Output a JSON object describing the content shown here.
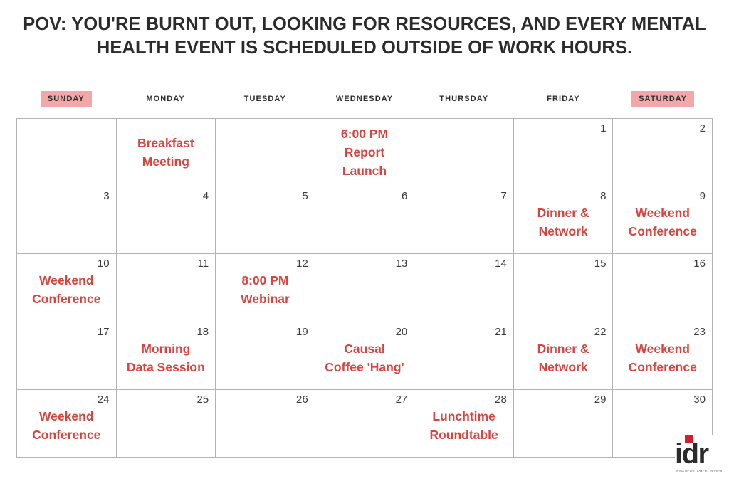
{
  "title": {
    "line1": "POV: YOU'RE BURNT OUT, LOOKING FOR RESOURCES, AND EVERY MENTAL",
    "line2": "HEALTH EVENT IS SCHEDULED OUTSIDE OF WORK HOURS."
  },
  "colors": {
    "event_red": "#d7453f",
    "header_highlight_pink": "#f2a7ab",
    "grid_border": "#b3b3b3",
    "title_text": "#2b2b2b",
    "day_number": "#3b3b3b",
    "logo_square_red": "#cf2030"
  },
  "weekdays": [
    {
      "label": "SUNDAY",
      "highlighted": true
    },
    {
      "label": "MONDAY",
      "highlighted": false
    },
    {
      "label": "TUESDAY",
      "highlighted": false
    },
    {
      "label": "WEDNESDAY",
      "highlighted": false
    },
    {
      "label": "THURSDAY",
      "highlighted": false
    },
    {
      "label": "FRIDAY",
      "highlighted": false
    },
    {
      "label": "SATURDAY",
      "highlighted": true
    }
  ],
  "weeks": [
    {
      "days": [
        {
          "number": "",
          "event": []
        },
        {
          "number": "",
          "event": [
            "Breakfast",
            "Meeting"
          ]
        },
        {
          "number": "",
          "event": []
        },
        {
          "number": "",
          "event": [
            "6:00 PM",
            "Report",
            "Launch"
          ]
        },
        {
          "number": "",
          "event": []
        },
        {
          "number": "1",
          "event": []
        },
        {
          "number": "2",
          "event": []
        }
      ]
    },
    {
      "days": [
        {
          "number": "3",
          "event": []
        },
        {
          "number": "4",
          "event": []
        },
        {
          "number": "5",
          "event": []
        },
        {
          "number": "6",
          "event": []
        },
        {
          "number": "7",
          "event": []
        },
        {
          "number": "8",
          "event": [
            "Dinner &",
            "Network"
          ]
        },
        {
          "number": "9",
          "event": [
            "Weekend",
            "Conference"
          ]
        }
      ]
    },
    {
      "days": [
        {
          "number": "10",
          "event": [
            "Weekend",
            "Conference"
          ]
        },
        {
          "number": "11",
          "event": []
        },
        {
          "number": "12",
          "event": [
            "8:00 PM",
            "Webinar"
          ]
        },
        {
          "number": "13",
          "event": []
        },
        {
          "number": "14",
          "event": []
        },
        {
          "number": "15",
          "event": []
        },
        {
          "number": "16",
          "event": []
        }
      ]
    },
    {
      "days": [
        {
          "number": "17",
          "event": []
        },
        {
          "number": "18",
          "event": [
            "Morning",
            "Data Session"
          ]
        },
        {
          "number": "19",
          "event": []
        },
        {
          "number": "20",
          "event": [
            "Causal",
            "Coffee 'Hang'"
          ]
        },
        {
          "number": "21",
          "event": []
        },
        {
          "number": "22",
          "event": [
            "Dinner &",
            "Network"
          ]
        },
        {
          "number": "23",
          "event": [
            "Weekend",
            "Conference"
          ]
        }
      ]
    },
    {
      "days": [
        {
          "number": "24",
          "event": [
            "Weekend",
            "Conference"
          ]
        },
        {
          "number": "25",
          "event": []
        },
        {
          "number": "26",
          "event": []
        },
        {
          "number": "27",
          "event": []
        },
        {
          "number": "28",
          "event": [
            "Lunchtime",
            "Roundtable"
          ]
        },
        {
          "number": "29",
          "event": []
        },
        {
          "number": "30",
          "event": []
        }
      ]
    }
  ],
  "logo": {
    "wordmark": "idr",
    "tagline": "INDIA DEVELOPMENT REVIEW"
  }
}
